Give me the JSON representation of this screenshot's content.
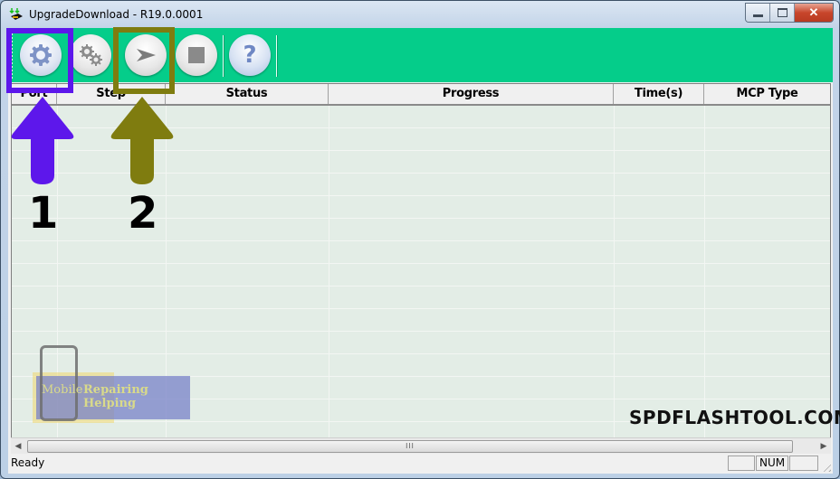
{
  "window": {
    "title": "UpgradeDownload - R19.0.0001",
    "caption_close": "✕"
  },
  "toolbar": {
    "buttons": [
      {
        "name": "load-packet",
        "icon": "gear-icon"
      },
      {
        "name": "edit-settings",
        "icon": "gears-icon"
      },
      {
        "name": "start-downloading",
        "icon": "play-arrow-icon"
      },
      {
        "name": "stop-downloading",
        "icon": "stop-icon"
      },
      {
        "name": "about",
        "icon": "help-icon",
        "glyph": "?"
      }
    ]
  },
  "table": {
    "columns": [
      "Port",
      "Step",
      "Status",
      "Progress",
      "Time(s)",
      "MCP Type"
    ],
    "rows": []
  },
  "scrollbar": {
    "thumb_grip": "III"
  },
  "statusbar": {
    "text": "Ready",
    "panes": [
      "",
      "NUM",
      ""
    ]
  },
  "annotations": {
    "label_1": "1",
    "label_2": "2",
    "highlight_1_color": "#5d17eb",
    "highlight_2_color": "#7f7c0f"
  },
  "watermarks": {
    "brand_left": "Mobile",
    "brand_right": "Repairing Helping",
    "site": "SPDFLASHTOOL.COM"
  },
  "colors": {
    "toolbar_bg": "#05cd8a",
    "grid_bg": "#e3ede6"
  }
}
